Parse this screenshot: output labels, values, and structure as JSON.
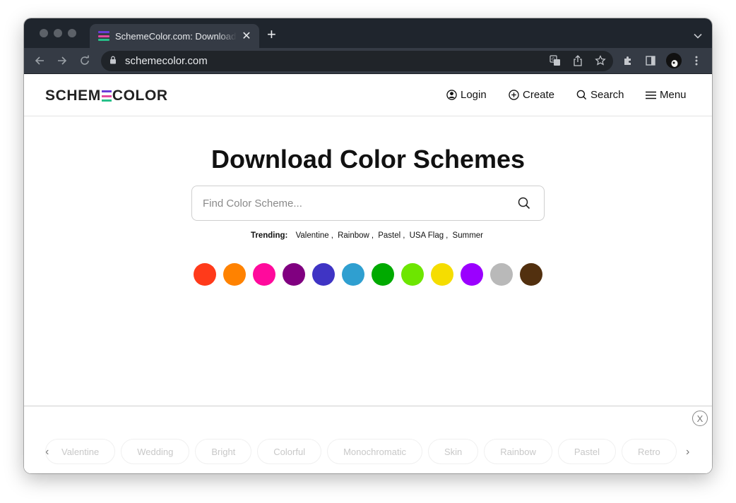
{
  "browser": {
    "tab_title": "SchemeColor.com: Download, Create and Share Color Schemes",
    "tab_close": "✕",
    "new_tab": "+",
    "url": "schemecolor.com",
    "icons": [
      "back-icon",
      "forward-icon",
      "reload-icon",
      "lock-icon",
      "translate-icon",
      "share-icon",
      "star-icon",
      "extensions-icon",
      "side-panel-icon",
      "profile-avatar",
      "more-menu-icon"
    ]
  },
  "site": {
    "logo_left": "SCHEM",
    "logo_right": "COLOR",
    "logo_colors": [
      "#6a3bd8",
      "#e34aa0",
      "#27c08a"
    ],
    "nav": {
      "login": "Login",
      "create": "Create",
      "search": "Search",
      "menu": "Menu"
    }
  },
  "main": {
    "headline": "Download Color Schemes",
    "search_placeholder": "Find Color Scheme...",
    "trending_label": "Trending:",
    "trending": [
      "Valentine",
      "Rainbow",
      "Pastel",
      "USA Flag",
      "Summer"
    ],
    "swatches": [
      "#ff3a1a",
      "#ff8200",
      "#ff0a9c",
      "#800080",
      "#3f34c4",
      "#2f9fd0",
      "#00aa00",
      "#6de600",
      "#f5dd00",
      "#9b00ff",
      "#b9b9b9",
      "#52300f"
    ]
  },
  "bottom_bar": {
    "close_label": "X",
    "prev_arrow": "‹",
    "next_arrow": "›",
    "tags": [
      "Valentine",
      "Wedding",
      "Bright",
      "Colorful",
      "Monochromatic",
      "Skin",
      "Rainbow",
      "Pastel",
      "Retro"
    ]
  }
}
